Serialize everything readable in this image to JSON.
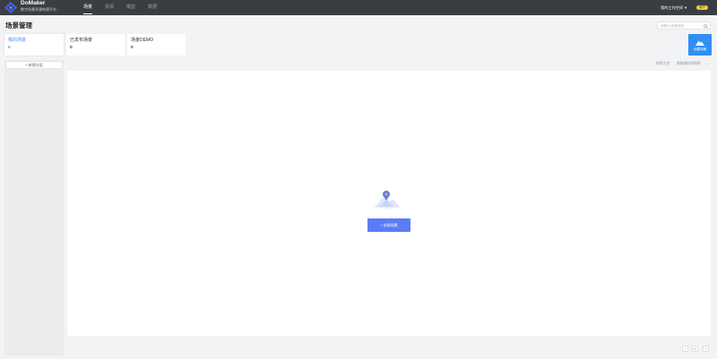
{
  "header": {
    "brand_name": "DoMaker",
    "brand_subtitle": "数字场景资源构建平台",
    "nav": [
      {
        "label": "场景",
        "active": true
      },
      {
        "label": "资源",
        "active": false
      },
      {
        "label": "模型",
        "active": false
      },
      {
        "label": "数据",
        "active": false
      }
    ],
    "workspace_label": "我的工作空间",
    "user_badge": "用户",
    "colors": {
      "bar": "#3a3d42",
      "badge": "#f2d13a"
    }
  },
  "page": {
    "title": "场景管理",
    "search_placeholder": "请输入关键搜索"
  },
  "categories": [
    {
      "label": "我的场景",
      "count": "0",
      "active": true
    },
    {
      "label": "已发布场景",
      "count": "0",
      "active": false
    },
    {
      "label": "场景DEMO",
      "count": "0",
      "active": false
    }
  ],
  "create_card": {
    "label": "创建场景",
    "icon": "mountain-icon"
  },
  "sidebar": {
    "new_category_label": "+ 新建分组"
  },
  "sort": {
    "label": "排序方式:",
    "value": "按修改时间排序"
  },
  "empty_state": {
    "button_label": "+ 创建场景",
    "illustration": "empty-scene-illustration"
  },
  "pagination": {
    "prev": "‹",
    "page": "1",
    "next": "›"
  },
  "accent_colors": {
    "primary": "#4a8df6",
    "create_card": "#2f8ff5",
    "button": "#5c7cf7"
  }
}
